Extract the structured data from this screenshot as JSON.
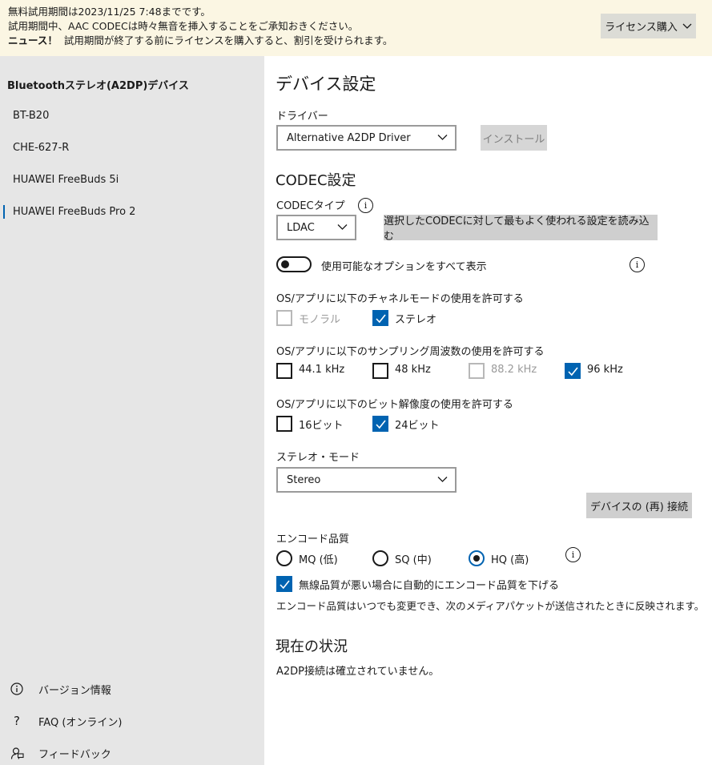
{
  "banner": {
    "line1": "無料試用期間は2023/11/25 7:48までです。",
    "line2": "試用期間中、AAC CODECは時々無音を挿入することをご承知おきください。",
    "news_label": "ニュース！",
    "news_text": "試用期間が終了する前にライセンスを購入すると、割引を受けられます。",
    "license_button": "ライセンス購入"
  },
  "sidebar": {
    "header": "Bluetoothステレオ(A2DP)デバイス",
    "devices": [
      "BT-B20",
      "CHE-627-R",
      "HUAWEI FreeBuds 5i",
      "HUAWEI FreeBuds Pro 2"
    ],
    "selected_index": 3,
    "footer": [
      {
        "label": "バージョン情報",
        "icon": "info-icon"
      },
      {
        "label": "FAQ (オンライン)",
        "icon": "question-icon"
      },
      {
        "label": "フィードバック",
        "icon": "feedback-icon"
      }
    ]
  },
  "main": {
    "title": "デバイス設定",
    "driver_label": "ドライバー",
    "driver_value": "Alternative A2DP Driver",
    "install_button": "インストール",
    "codec_heading": "CODEC設定",
    "codec_type_label": "CODECタイプ",
    "codec_value": "LDAC",
    "load_settings_button": "選択したCODECに対して最もよく使われる設定を読み込む",
    "show_all_options_label": "使用可能なオプションをすべて表示",
    "show_all_options_on": false,
    "channel_mode_label": "OS/アプリに以下のチャネルモードの使用を許可する",
    "channel_modes": [
      {
        "label": "モノラル",
        "checked": false,
        "disabled": true
      },
      {
        "label": "ステレオ",
        "checked": true,
        "disabled": false
      }
    ],
    "sampling_label": "OS/アプリに以下のサンプリング周波数の使用を許可する",
    "sampling_rates": [
      {
        "label": "44.1 kHz",
        "checked": false,
        "disabled": false
      },
      {
        "label": "48 kHz",
        "checked": false,
        "disabled": false
      },
      {
        "label": "88.2 kHz",
        "checked": false,
        "disabled": true
      },
      {
        "label": "96 kHz",
        "checked": true,
        "disabled": false
      }
    ],
    "bit_depth_label": "OS/アプリに以下のビット解像度の使用を許可する",
    "bit_depths": [
      {
        "label": "16ビット",
        "checked": false,
        "disabled": false
      },
      {
        "label": "24ビット",
        "checked": true,
        "disabled": false
      }
    ],
    "stereo_mode_label": "ステレオ・モード",
    "stereo_mode_value": "Stereo",
    "reconnect_button": "デバイスの (再) 接続",
    "encode_quality_label": "エンコード品質",
    "encode_options": [
      {
        "label": "MQ (低)",
        "checked": false
      },
      {
        "label": "SQ (中)",
        "checked": false
      },
      {
        "label": "HQ (高)",
        "checked": true
      }
    ],
    "auto_lower_label": "無線品質が悪い場合に自動的にエンコード品質を下げる",
    "auto_lower_checked": true,
    "encode_note": "エンコード品質はいつでも変更でき、次のメディアパケットが送信されたときに反映されます。",
    "status_heading": "現在の状況",
    "status_text": "A2DP接続は確立されていません。"
  },
  "colors": {
    "accent": "#0063b1",
    "banner_bg": "#fbf6e3",
    "sidebar_bg": "#e6e6e6",
    "button_bg": "#cfcfcf"
  }
}
